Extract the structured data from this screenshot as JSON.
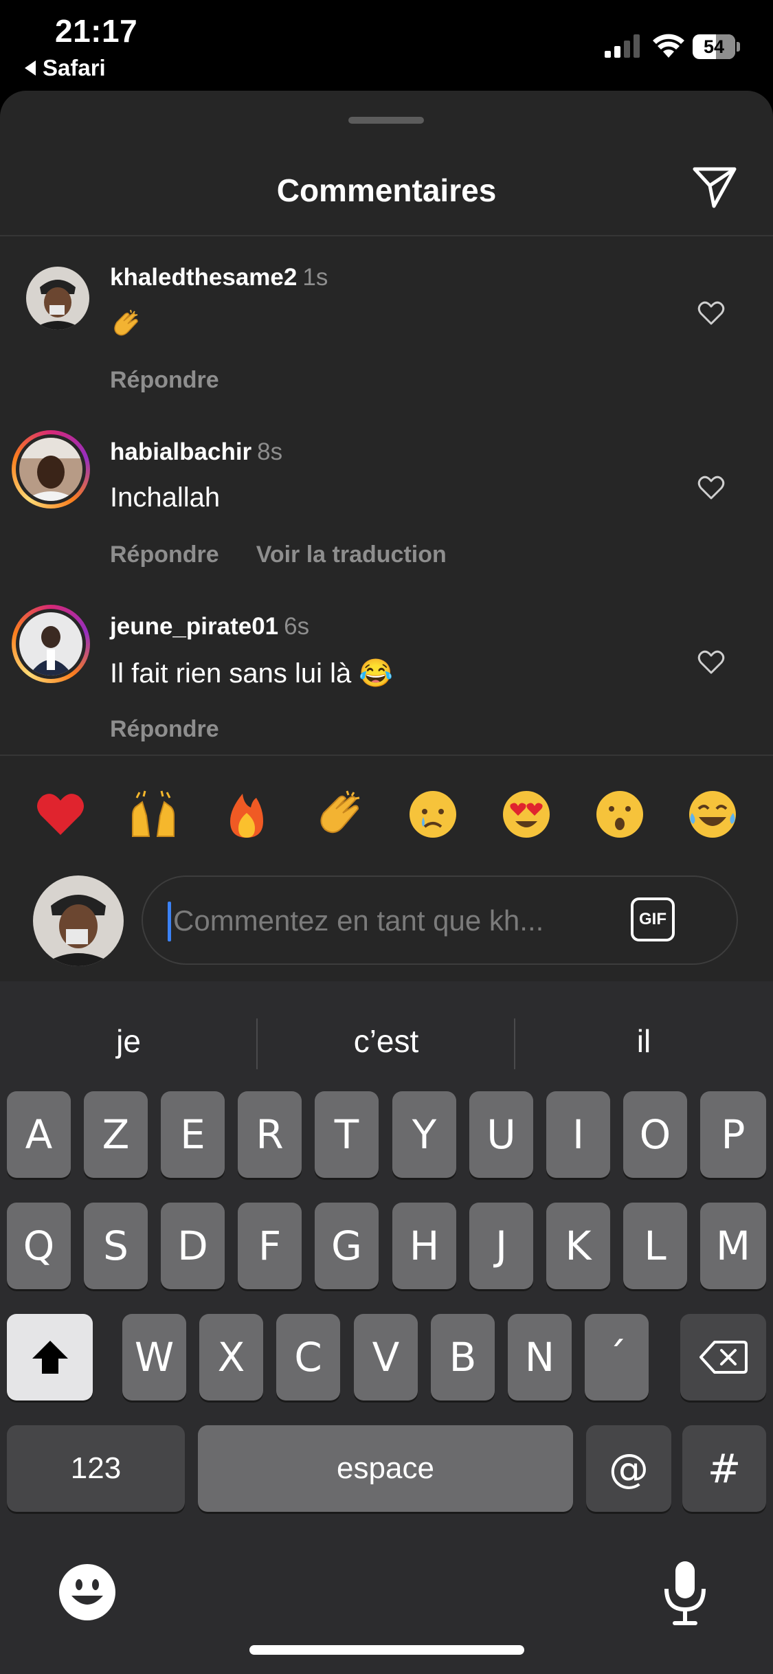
{
  "status_bar": {
    "time": "21:17",
    "back_label": "Safari",
    "battery": "54"
  },
  "sheet": {
    "title": "Commentaires",
    "share_icon": "send-icon"
  },
  "comments": [
    {
      "username": "khaledthesame2",
      "age": "1s",
      "text": "👏",
      "actions": [
        "Répondre"
      ],
      "story_ring": false
    },
    {
      "username": "habialbachir",
      "age": "8s",
      "text": "Inchallah",
      "actions": [
        "Répondre",
        "Voir la traduction"
      ],
      "story_ring": true
    },
    {
      "username": "jeune_pirate01",
      "age": "6s",
      "text": "Il fait rien sans lui là 😂",
      "actions": [
        "Répondre"
      ],
      "story_ring": true
    }
  ],
  "quick_reactions": [
    "red-heart",
    "raising-hands",
    "fire",
    "clapping-hands",
    "crying-face",
    "heart-eyes",
    "surprised-face",
    "tears-of-joy"
  ],
  "comment_input": {
    "placeholder": "Commentez en tant que kh...",
    "gif_label": "GIF"
  },
  "keyboard": {
    "suggestions": [
      "je",
      "c’est",
      "il"
    ],
    "row1": [
      "A",
      "Z",
      "E",
      "R",
      "T",
      "Y",
      "U",
      "I",
      "O",
      "P"
    ],
    "row2": [
      "Q",
      "S",
      "D",
      "F",
      "G",
      "H",
      "J",
      "K",
      "L",
      "M"
    ],
    "row3": [
      "W",
      "X",
      "C",
      "V",
      "B",
      "N",
      "´"
    ],
    "numbers_label": "123",
    "space_label": "espace",
    "at_label": "@",
    "hash_label": "#"
  },
  "colors": {
    "sheet_bg": "#262626",
    "keyboard_bg": "#2c2c2e",
    "secondary_text": "#8e8e8e",
    "caret": "#3b82f6"
  }
}
